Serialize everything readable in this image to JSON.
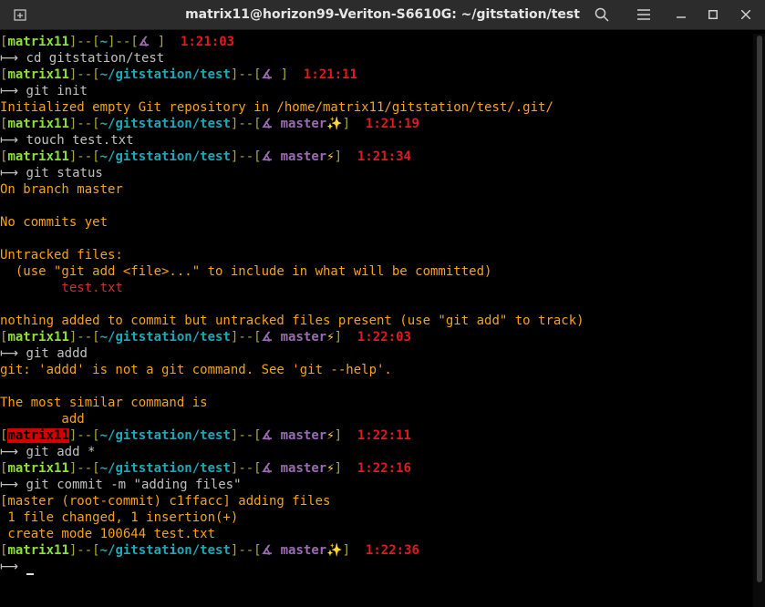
{
  "window": {
    "title": "matrix11@horizon99-Veriton-S6610G: ~/gitstation/test"
  },
  "icons": {
    "new_tab": "new-tab-icon",
    "search": "search-icon",
    "menu": "hamburger-menu-icon",
    "minimize": "minimize-icon",
    "maximize": "maximize-icon",
    "close": "close-icon"
  },
  "colors": {
    "user": "#8ae234",
    "path": "#21a6b8",
    "branch": "#9a6bb5",
    "time": "#e01b1b",
    "output": "#f6a21a",
    "untracked": "#d32f2f"
  },
  "prompt": {
    "user": "matrix11",
    "home": "~",
    "path": "~/gitstation/test",
    "branch": "master",
    "arrow": "⟼"
  },
  "lines": [
    {
      "kind": "prompt_home",
      "time": "1:21:03"
    },
    {
      "kind": "cmd",
      "text": "cd gitstation/test"
    },
    {
      "kind": "prompt_nobranch",
      "time": "1:21:11"
    },
    {
      "kind": "cmd",
      "text": "git init"
    },
    {
      "kind": "out",
      "text": "Initialized empty Git repository in /home/matrix11/gitstation/test/.git/"
    },
    {
      "kind": "prompt_branch",
      "status": "✨",
      "time": "1:21:19"
    },
    {
      "kind": "cmd",
      "text": "touch test.txt"
    },
    {
      "kind": "prompt_branch",
      "status": "⚡",
      "time": "1:21:34"
    },
    {
      "kind": "cmd",
      "text": "git status"
    },
    {
      "kind": "out",
      "text": "On branch master"
    },
    {
      "kind": "out",
      "text": ""
    },
    {
      "kind": "out",
      "text": "No commits yet"
    },
    {
      "kind": "out",
      "text": ""
    },
    {
      "kind": "out",
      "text": "Untracked files:"
    },
    {
      "kind": "out",
      "text": "  (use \"git add <file>...\" to include in what will be committed)"
    },
    {
      "kind": "untracked",
      "text": "        test.txt"
    },
    {
      "kind": "out",
      "text": ""
    },
    {
      "kind": "out",
      "text": "nothing added to commit but untracked files present (use \"git add\" to track)"
    },
    {
      "kind": "prompt_branch",
      "status": "⚡",
      "time": "1:22:03"
    },
    {
      "kind": "cmd",
      "text": "git addd"
    },
    {
      "kind": "out",
      "text": "git: 'addd' is not a git command. See 'git --help'."
    },
    {
      "kind": "out",
      "text": ""
    },
    {
      "kind": "out",
      "text": "The most similar command is"
    },
    {
      "kind": "out",
      "text": "        add"
    },
    {
      "kind": "prompt_branch_error",
      "status": "⚡",
      "time": "1:22:11"
    },
    {
      "kind": "cmd",
      "text": "git add *"
    },
    {
      "kind": "prompt_branch",
      "status": "⚡",
      "time": "1:22:16"
    },
    {
      "kind": "cmd",
      "text": "git commit -m \"adding files\""
    },
    {
      "kind": "out",
      "text": "[master (root-commit) c1ffacc] adding files"
    },
    {
      "kind": "out",
      "text": " 1 file changed, 1 insertion(+)"
    },
    {
      "kind": "out",
      "text": " create mode 100644 test.txt"
    },
    {
      "kind": "prompt_branch",
      "status": "✨",
      "time": "1:22:36"
    },
    {
      "kind": "input",
      "text": ""
    }
  ]
}
